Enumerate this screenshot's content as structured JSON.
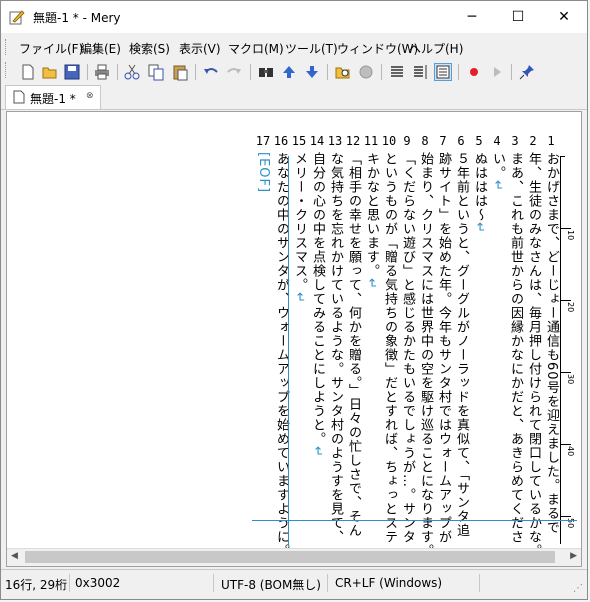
{
  "window": {
    "title": "無題-1 * - Mery"
  },
  "menu": [
    "ファイル(F)",
    "編集(E)",
    "検索(S)",
    "表示(V)",
    "マクロ(M)",
    "ツール(T)",
    "ウィンドウ(W)",
    "ヘルプ(H)"
  ],
  "toolbar": {
    "icons": [
      "new-file-icon",
      "open-folder-icon",
      "save-icon",
      "print-icon",
      "cut-icon",
      "copy-icon",
      "paste-icon",
      "undo-icon",
      "redo-icon",
      "find-icon",
      "find-up-icon",
      "find-down-icon",
      "grep-icon",
      "clear-highlight-icon",
      "wrap-none-icon",
      "wrap-width-icon",
      "wrap-window-icon",
      "record-icon",
      "play-icon",
      "pin-icon"
    ]
  },
  "tab": {
    "label": "無題-1 *",
    "close": "⊗"
  },
  "editor": {
    "line_numbers": [
      "1",
      "2",
      "3",
      "4",
      "5",
      "6",
      "7",
      "8",
      "9",
      "10",
      "11",
      "12",
      "13",
      "14",
      "15",
      "16",
      "17"
    ],
    "ruler_numbers": [
      "10",
      "20",
      "30",
      "40",
      "50"
    ],
    "lines": [
      "おかげさまで、どーじょー通信も60号を迎えました。まるで",
      "年、生徒のみなさんは、毎月押し付けられて閉口しているかな。",
      "まあ、これも前世からの因縁かなにかだと、あきらめてくださ",
      "い。",
      "ぬははは～",
      "５年前というと、グーグルがノーラッドを真似て、「サンタ追",
      "跡サイト」を始めた年。今年もサンタ村ではウォームアップが",
      "始まり、クリスマスには世界中の空を駆け巡ることになります。",
      "「くだらない遊び」と感じるかたもいるでしょうが…。サンタ",
      "というものが「贈る気持ちの象徴」だとすれば、ちょっとステ",
      "キかなと思います。",
      "「相手の幸せを願って、何かを贈る。」日々の忙しさで、そん",
      "な気持ちを忘れかけているような。サンタ村のようすを見て、",
      "自分の心の中を点検してみることにしようと。",
      "メリー・クリスマス。",
      "あなたの中のサンタが、ウォームアップを始めていますように。",
      "[EOF]"
    ],
    "return_mark": "↵"
  },
  "status": {
    "position": "16行, 29桁",
    "code": "0x3002",
    "encoding": "UTF-8 (BOM無し)",
    "newline": "CR+LF (Windows)"
  }
}
